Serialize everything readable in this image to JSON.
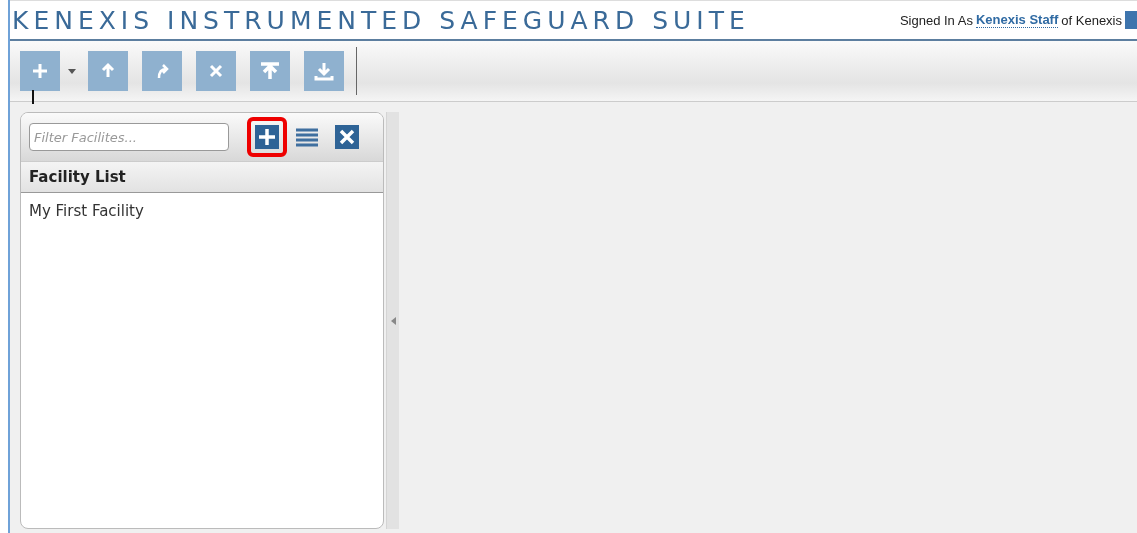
{
  "header": {
    "title": "KENEXIS INSTRUMENTED SAFEGUARD SUITE",
    "signed_in_prefix": "Signed In As",
    "user": "Kenexis Staff",
    "org_suffix": "of Kenexis"
  },
  "facility_panel": {
    "filter": {
      "placeholder": "Filter Facilites..."
    },
    "buttons": [
      {
        "kind": "add",
        "highlighted": true
      },
      {
        "kind": "list",
        "highlighted": false
      },
      {
        "kind": "close",
        "highlighted": false
      }
    ],
    "list_header": "Facility List",
    "items": [
      {
        "label": "My First Facility",
        "selected": false
      }
    ]
  }
}
